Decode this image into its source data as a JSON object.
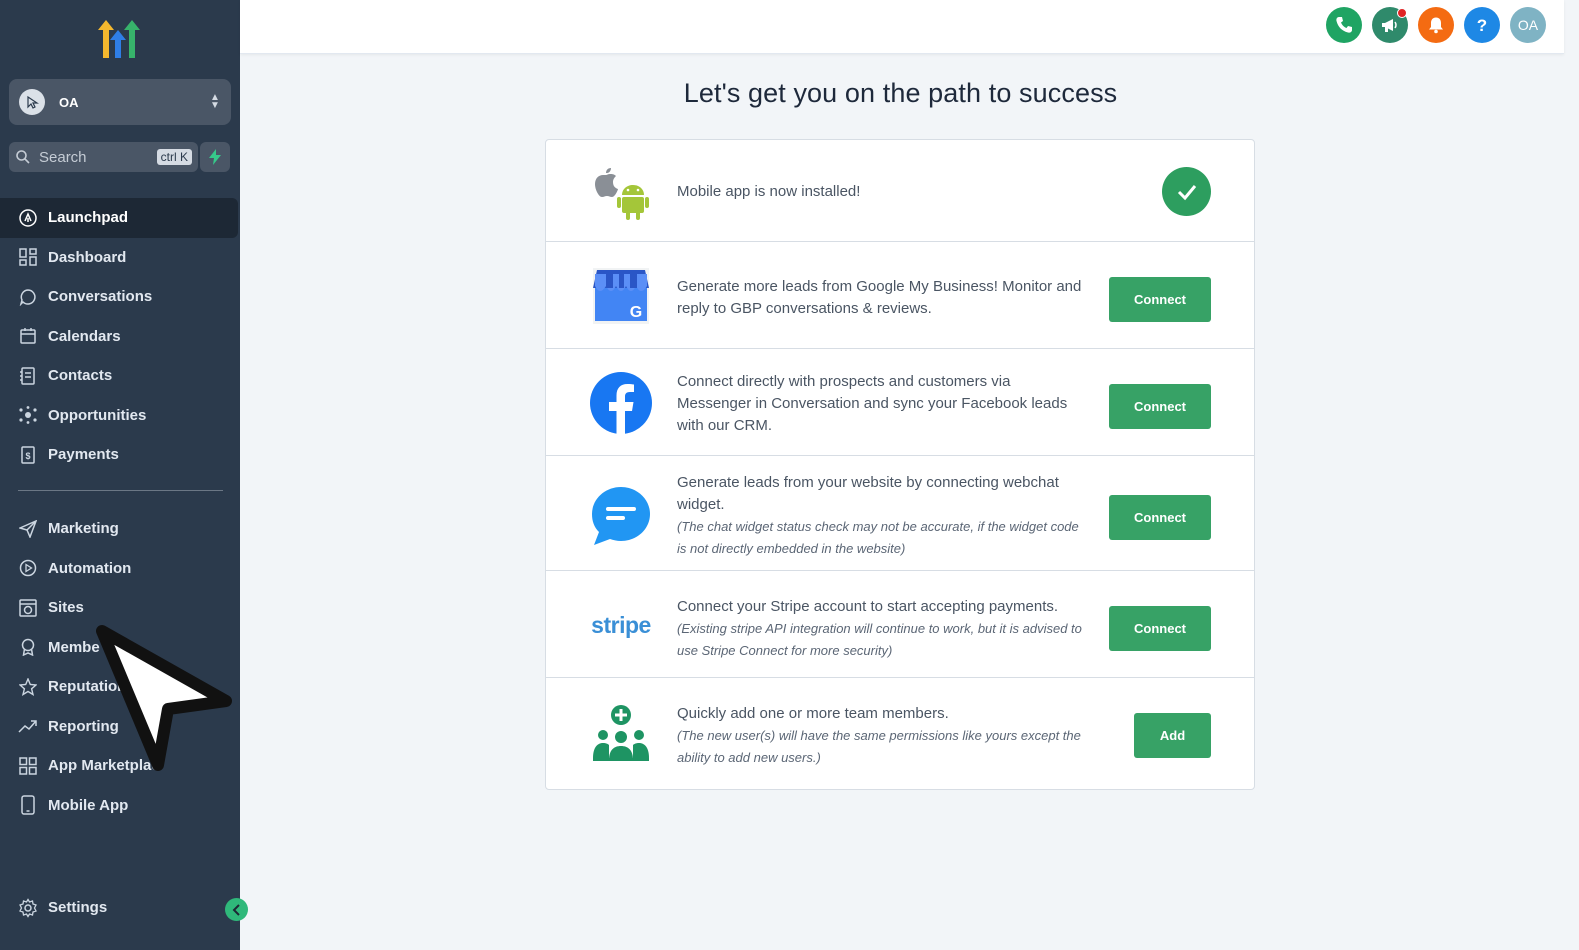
{
  "sidebar": {
    "account": {
      "name": "OA"
    },
    "search": {
      "placeholder": "Search",
      "shortcut": "ctrl K"
    },
    "nav_items": [
      {
        "label": "Launchpad",
        "icon": "rocket-icon",
        "active": true
      },
      {
        "label": "Dashboard",
        "icon": "grid-icon"
      },
      {
        "label": "Conversations",
        "icon": "chat-bubble-icon"
      },
      {
        "label": "Calendars",
        "icon": "calendar-icon"
      },
      {
        "label": "Contacts",
        "icon": "contact-book-icon"
      },
      {
        "label": "Opportunities",
        "icon": "network-icon"
      },
      {
        "label": "Payments",
        "icon": "invoice-icon"
      }
    ],
    "nav_items_2": [
      {
        "label": "Marketing",
        "icon": "paper-plane-icon"
      },
      {
        "label": "Automation",
        "icon": "play-circle-icon"
      },
      {
        "label": "Sites",
        "icon": "globe-window-icon"
      },
      {
        "label": "Membe",
        "icon": "award-icon"
      },
      {
        "label": "Reputation",
        "icon": "star-icon"
      },
      {
        "label": "Reporting",
        "icon": "trend-up-icon"
      },
      {
        "label": "App Marketplac",
        "icon": "apps-grid-icon"
      },
      {
        "label": "Mobile App",
        "icon": "phone-device-icon"
      }
    ],
    "settings_label": "Settings"
  },
  "topbar": {
    "user_initials": "OA",
    "icons": [
      "phone-icon",
      "megaphone-icon",
      "bell-icon",
      "help-icon",
      "user-avatar"
    ],
    "colors": {
      "phone": "#1fa463",
      "megaphone": "#2f8a6b",
      "bell": "#f46b12",
      "help": "#1e88e5",
      "avatar": "#7fb3c4"
    }
  },
  "main": {
    "title": "Let's get you on the path to success",
    "rows": [
      {
        "icon": "apple-android-icon",
        "desc": "Mobile app is now installed!",
        "status": "completed"
      },
      {
        "icon": "google-my-business-icon",
        "desc": "Generate more leads from Google My Business! Monitor and reply to GBP conversations & reviews.",
        "button": "Connect"
      },
      {
        "icon": "facebook-icon",
        "desc": "Connect directly with prospects and customers via Messenger in Conversation and sync your Facebook leads with our CRM.",
        "button": "Connect"
      },
      {
        "icon": "webchat-icon",
        "desc": "Generate leads from your website by connecting webchat widget.",
        "note": "(The chat widget status check may not be accurate, if the widget code is not directly embedded in the website)",
        "button": "Connect"
      },
      {
        "icon": "stripe-logo",
        "logo_text": "stripe",
        "desc": "Connect your Stripe account to start accepting payments.",
        "note": "(Existing stripe API integration will continue to work, but it is advised to use Stripe Connect for more security)",
        "button": "Connect"
      },
      {
        "icon": "team-add-icon",
        "desc": "Quickly add one or more team members.",
        "note": "(The new user(s) will have the same permissions like yours except the ability to add new users.)",
        "button": "Add"
      }
    ]
  }
}
